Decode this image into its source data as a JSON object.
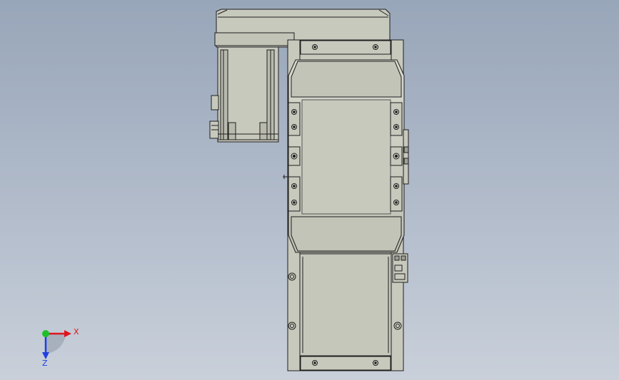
{
  "viewport": {
    "background_top": "#98a6b9",
    "background_bottom": "#c9d0da",
    "part_fill": "#c8c9bd",
    "part_fill_dark": "#b9baae",
    "edge_color": "#1e1e1e"
  },
  "triad": {
    "x_label": "X",
    "z_label": "Z",
    "x_color": "#e0141e",
    "y_color": "#1fbf2a",
    "z_color": "#1f3fe0"
  }
}
